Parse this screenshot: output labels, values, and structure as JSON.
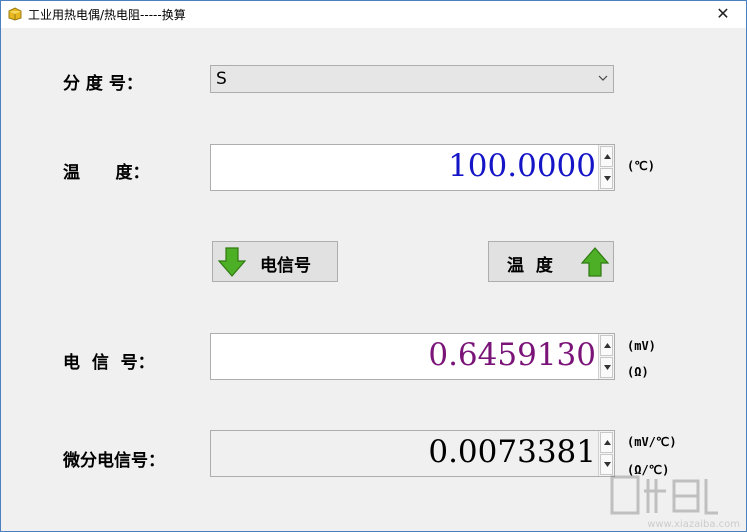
{
  "window": {
    "title": "工业用热电偶/热电阻-----换算",
    "close_glyph": "✕"
  },
  "graduation": {
    "label": "分 度 号：",
    "selected": "S"
  },
  "temperature": {
    "label": "温      度：",
    "value": "100.0000",
    "value_color": "#1515c8",
    "unit": "(℃)"
  },
  "buttons": {
    "to_signal_label": "电信号",
    "to_temp_label": "温  度",
    "arrow_color": "#4caf26"
  },
  "signal": {
    "label": "电  信  号：",
    "value": "0.6459130",
    "value_color": "#7b1478",
    "unit_mv": "(mV)",
    "unit_ohm": "(Ω)"
  },
  "differential": {
    "label": "微分电信号：",
    "value": "0.0073381",
    "value_color": "#000000",
    "unit_mv": "(mV/℃)",
    "unit_ohm": "(Ω/℃)"
  },
  "watermark": {
    "site": "www.xiazaiba.com"
  },
  "icons": {
    "app": "app-icon",
    "close": "close-icon",
    "dropdown": "chevron-down-icon",
    "spin_up": "spin-up-icon",
    "spin_down": "spin-down-icon",
    "arrow_down": "arrow-down-icon",
    "arrow_up": "arrow-up-icon"
  }
}
